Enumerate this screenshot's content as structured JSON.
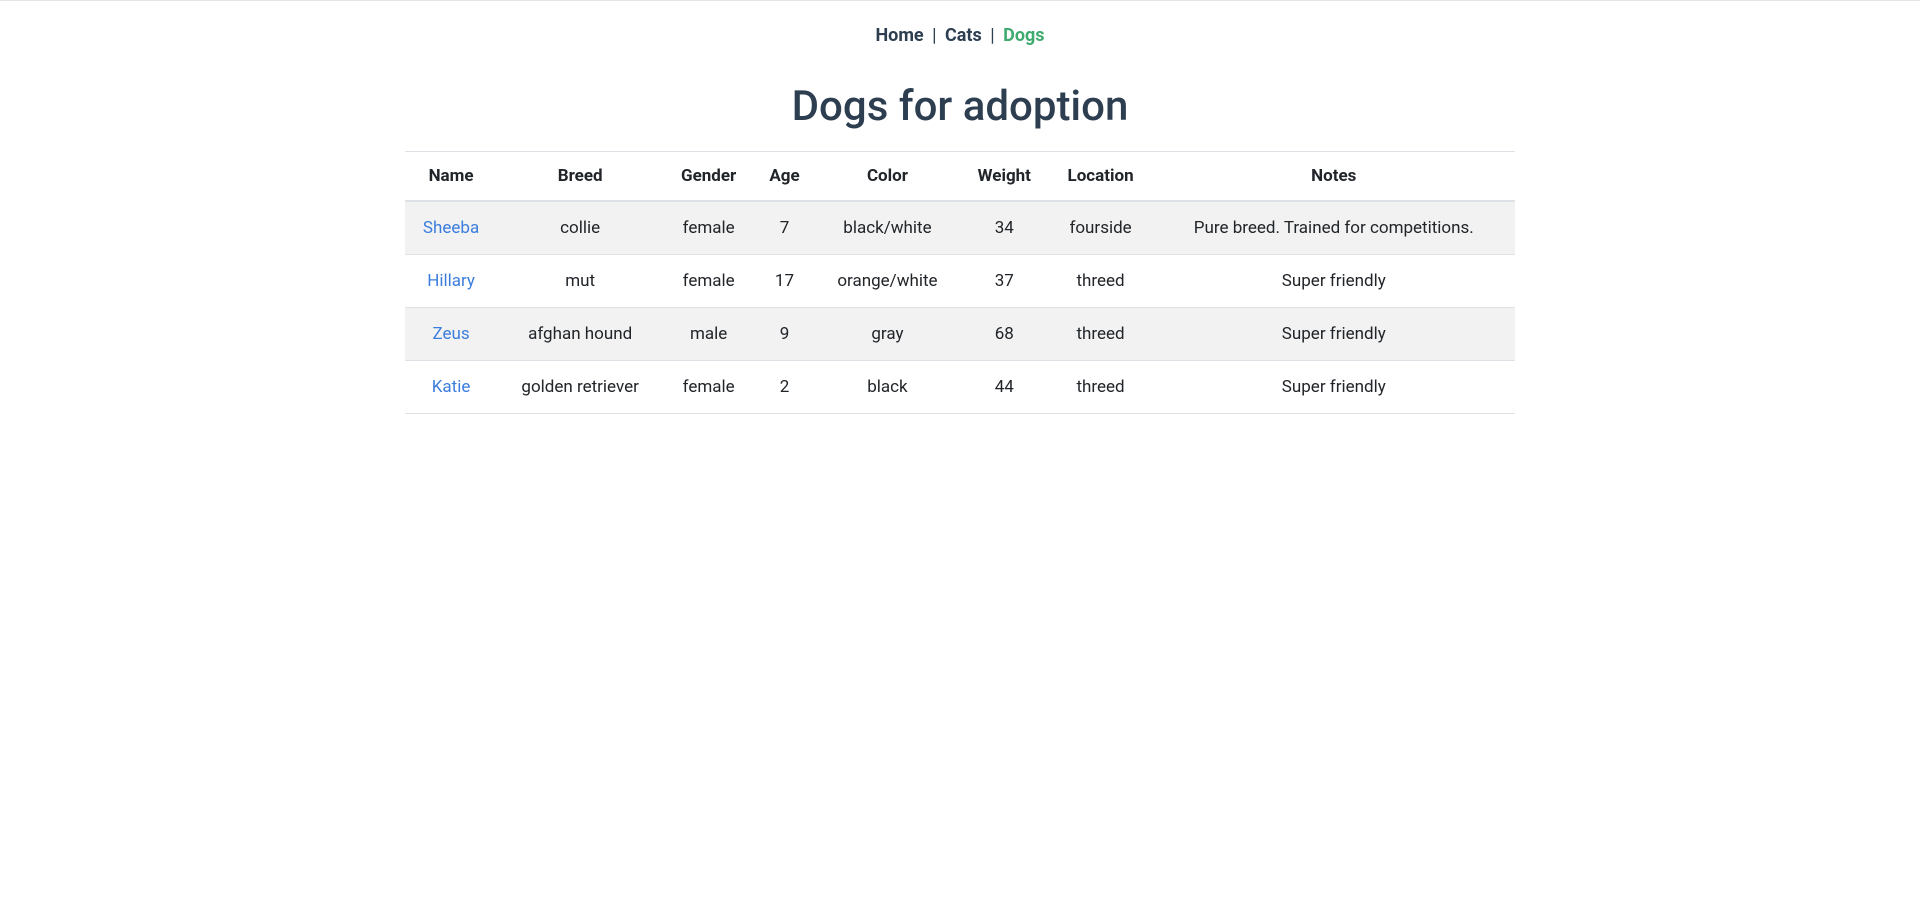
{
  "nav": {
    "home": "Home",
    "cats": "Cats",
    "dogs": "Dogs"
  },
  "title": "Dogs for adoption",
  "columns": {
    "name": "Name",
    "breed": "Breed",
    "gender": "Gender",
    "age": "Age",
    "color": "Color",
    "weight": "Weight",
    "location": "Location",
    "notes": "Notes"
  },
  "rows": [
    {
      "name": "Sheeba",
      "breed": "collie",
      "gender": "female",
      "age": "7",
      "color": "black/white",
      "weight": "34",
      "location": "fourside",
      "notes": "Pure breed. Trained for competitions."
    },
    {
      "name": "Hillary",
      "breed": "mut",
      "gender": "female",
      "age": "17",
      "color": "orange/white",
      "weight": "37",
      "location": "threed",
      "notes": "Super friendly"
    },
    {
      "name": "Zeus",
      "breed": "afghan hound",
      "gender": "male",
      "age": "9",
      "color": "gray",
      "weight": "68",
      "location": "threed",
      "notes": "Super friendly"
    },
    {
      "name": "Katie",
      "breed": "golden retriever",
      "gender": "female",
      "age": "2",
      "color": "black",
      "weight": "44",
      "location": "threed",
      "notes": "Super friendly"
    }
  ]
}
